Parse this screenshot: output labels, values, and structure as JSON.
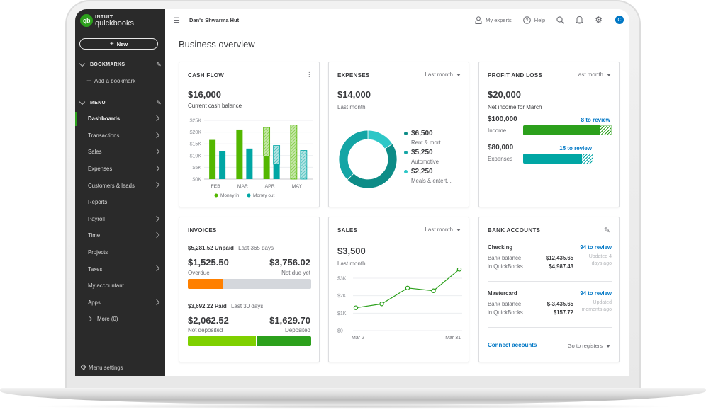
{
  "sidebar": {
    "logo_top": "INTUIT",
    "logo_bottom": "quickbooks",
    "new_label": "New",
    "bookmarks_label": "BOOKMARKS",
    "add_bookmark": "Add a bookmark",
    "menu_label": "MENU",
    "items": [
      {
        "label": "Dashboards",
        "arrow": true,
        "active": true
      },
      {
        "label": "Transactions",
        "arrow": true
      },
      {
        "label": "Sales",
        "arrow": true
      },
      {
        "label": "Expenses",
        "arrow": true
      },
      {
        "label": "Customers & leads",
        "arrow": true
      },
      {
        "label": "Reports",
        "arrow": false
      },
      {
        "label": "Payroll",
        "arrow": true
      },
      {
        "label": "Time",
        "arrow": true
      },
      {
        "label": "Projects",
        "arrow": false
      },
      {
        "label": "Taxes",
        "arrow": true
      },
      {
        "label": "My accountant",
        "arrow": false
      },
      {
        "label": "Apps",
        "arrow": true
      }
    ],
    "more": "More (0)",
    "menu_settings": "Menu settings"
  },
  "topbar": {
    "company": "Dan's Shwarma Hut",
    "my_experts": "My experts",
    "help": "Help",
    "avatar_initial": "C"
  },
  "page_title": "Business overview",
  "cash_flow": {
    "title": "CASH FLOW",
    "amount": "$16,000",
    "caption": "Current cash balance",
    "legend_in": "Money in",
    "legend_out": "Money out"
  },
  "expenses": {
    "title": "EXPENSES",
    "period": "Last month",
    "amount": "$14,000",
    "caption": "Last month",
    "items": [
      {
        "amount": "$6,500",
        "label": "Rent & mort...",
        "value": 6500,
        "color": "#0d8c87"
      },
      {
        "amount": "$5,250",
        "label": "Automotive",
        "value": 5250,
        "color": "#14a5a5"
      },
      {
        "amount": "$2,250",
        "label": "Meals & entert...",
        "value": 2250,
        "color": "#2dc7c7"
      }
    ]
  },
  "profit_loss": {
    "title": "PROFIT AND LOSS",
    "period": "Last month",
    "amount": "$20,000",
    "caption": "Net income for March",
    "income_amount": "$100,000",
    "income_label": "Income",
    "income_review": "8 to review",
    "income_fraction": 0.86,
    "expenses_amount": "$80,000",
    "expenses_label": "Expenses",
    "expenses_review": "15 to review",
    "expenses_fraction": 0.84
  },
  "invoices": {
    "title": "INVOICES",
    "unpaid_amount": "$5,281.52 Unpaid",
    "unpaid_period": "Last 365 days",
    "overdue_amount": "$1,525.50",
    "overdue_label": "Overdue",
    "not_due_amount": "$3,756.02",
    "not_due_label": "Not due yet",
    "overdue_fraction": 0.29,
    "paid_amount": "$3,692.22 Paid",
    "paid_period": "Last 30 days",
    "not_deposited_amount": "$2,062.52",
    "not_deposited_label": "Not deposited",
    "deposited_amount": "$1,629.70",
    "deposited_label": "Deposited",
    "not_deposited_fraction": 0.56
  },
  "sales": {
    "title": "SALES",
    "period": "Last month",
    "amount": "$3,500",
    "caption": "Last month"
  },
  "bank_accounts": {
    "title": "BANK ACCOUNTS",
    "accounts": [
      {
        "name": "Checking",
        "review": "94 to review",
        "bank_label": "Bank balance",
        "bank_value": "$12,435.65",
        "qb_label": "in QuickBooks",
        "qb_value": "$4,987.43",
        "updated_1": "Updated 4",
        "updated_2": "days ago"
      },
      {
        "name": "Mastercard",
        "review": "94 to review",
        "bank_label": "Bank balance",
        "bank_value": "$-3,435.65",
        "qb_label": "in QuickBooks",
        "qb_value": "$157.72",
        "updated_1": "Updated",
        "updated_2": "moments ago"
      }
    ],
    "connect": "Connect accounts",
    "registers": "Go to registers"
  },
  "chart_data": [
    {
      "type": "bar",
      "title": "CASH FLOW",
      "categories": [
        "FEB",
        "MAR",
        "APR",
        "MAY"
      ],
      "series": [
        {
          "name": "Money in",
          "values": [
            16.7,
            21.1,
            9.8,
            0
          ],
          "projected": [
            16.7,
            21.1,
            22.0,
            23.0
          ],
          "color": "#53b700"
        },
        {
          "name": "Money out",
          "values": [
            11.9,
            13.0,
            6.3,
            0
          ],
          "projected": [
            11.9,
            13.0,
            14.3,
            12.2
          ],
          "color": "#00a6a4"
        }
      ],
      "yticks": [
        "$0K",
        "$5K",
        "$10K",
        "$15K",
        "$20K",
        "$25K"
      ],
      "ylim": [
        0,
        25
      ],
      "unit": "K USD",
      "legend": "bottom"
    },
    {
      "type": "pie",
      "title": "EXPENSES",
      "labels": [
        "Rent & mort...",
        "Automotive",
        "Meals & entert..."
      ],
      "values": [
        6500,
        5250,
        2250
      ]
    },
    {
      "type": "line",
      "title": "SALES",
      "x": [
        "Mar 2",
        "",
        "",
        "",
        "Mar 31"
      ],
      "values": [
        1.31,
        1.53,
        2.44,
        2.28,
        3.51
      ],
      "yticks": [
        "$0",
        "$1K",
        "$2K",
        "$3K"
      ],
      "ylim": [
        0,
        3.6
      ],
      "unit": "K USD",
      "color": "#2ca01c"
    }
  ]
}
